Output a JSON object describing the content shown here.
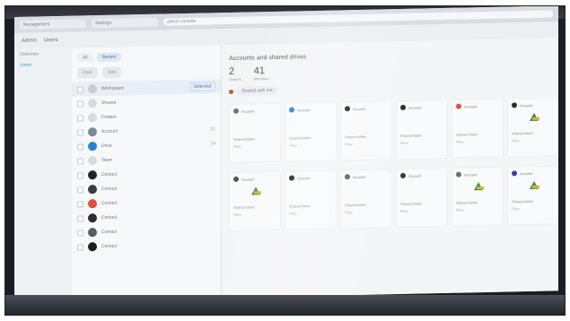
{
  "browser": {
    "tabs": [
      "Management",
      "Settings"
    ],
    "address": "admin console"
  },
  "app": {
    "breadcrumb": [
      "Admin",
      "Users"
    ]
  },
  "leftnav": {
    "items": [
      "Overview",
      "Users"
    ],
    "active_index": 1
  },
  "panel": {
    "tabs": [
      "All",
      "Recent"
    ],
    "actions": [
      "Filter",
      "Sort"
    ],
    "rows": [
      {
        "label": "Workspace",
        "meta": "",
        "badge": "Selected",
        "color": "#c9cdd3"
      },
      {
        "label": "Shared",
        "meta": "",
        "badge": "",
        "color": "#d7dbe0"
      },
      {
        "label": "Folders",
        "meta": "",
        "badge": "",
        "color": "#d7dbe0"
      },
      {
        "label": "Account",
        "meta": "21",
        "badge": "",
        "color": "#7b8a97"
      },
      {
        "label": "Drive",
        "meta": "14",
        "badge": "",
        "color": "#2f7fd1"
      },
      {
        "label": "Team",
        "meta": "",
        "badge": "",
        "color": "#d7dbe0"
      },
      {
        "label": "Contact",
        "meta": "",
        "badge": "",
        "color": "#1f2228"
      },
      {
        "label": "Contact",
        "meta": "",
        "badge": "",
        "color": "#3a3d44"
      },
      {
        "label": "Contact",
        "meta": "",
        "badge": "",
        "color": "#e0503c"
      },
      {
        "label": "Contact",
        "meta": "",
        "badge": "",
        "color": "#2b2d33"
      },
      {
        "label": "Contact",
        "meta": "",
        "badge": "",
        "color": "#595e66"
      },
      {
        "label": "Contact",
        "meta": "",
        "badge": "",
        "color": "#1c1e22"
      }
    ]
  },
  "main": {
    "title": "Accounts and shared drives",
    "stats": [
      {
        "value": "2",
        "label": "Owners"
      },
      {
        "value": "41",
        "label": "Members"
      }
    ],
    "filter_chip": "Shared with me",
    "cards": [
      {
        "name": "Account",
        "avatar": "#5f7a94",
        "title": "Shared folder",
        "sub": "Files",
        "drive": false
      },
      {
        "name": "Account",
        "avatar": "#2f7fd1",
        "title": "Shared folder",
        "sub": "Files",
        "drive": false
      },
      {
        "name": "Account",
        "avatar": "#1f2228",
        "title": "Shared folder",
        "sub": "Files",
        "drive": false
      },
      {
        "name": "Account",
        "avatar": "#2a2c31",
        "title": "Shared folder",
        "sub": "Files",
        "drive": false
      },
      {
        "name": "Account",
        "avatar": "#e0503c",
        "title": "Shared folder",
        "sub": "Files",
        "drive": false
      },
      {
        "name": "Account",
        "avatar": "#2b2d33",
        "title": "Shared folder",
        "sub": "Files",
        "drive": true
      },
      {
        "name": "Account",
        "avatar": "#4c5158",
        "title": "Shared folder",
        "sub": "Files",
        "drive": true
      },
      {
        "name": "Account",
        "avatar": "#1c1e22",
        "title": "Shared folder",
        "sub": "Files",
        "drive": false
      },
      {
        "name": "Account",
        "avatar": "#5a5f66",
        "title": "Shared folder",
        "sub": "Files",
        "drive": false
      },
      {
        "name": "Account",
        "avatar": "#3a3d44",
        "title": "Shared folder",
        "sub": "Files",
        "drive": false
      },
      {
        "name": "Account",
        "avatar": "#6b7078",
        "title": "Shared folder",
        "sub": "Files",
        "drive": true
      },
      {
        "name": "Account",
        "avatar": "#3b3fa8",
        "title": "Shared folder",
        "sub": "Files",
        "drive": true
      }
    ]
  }
}
